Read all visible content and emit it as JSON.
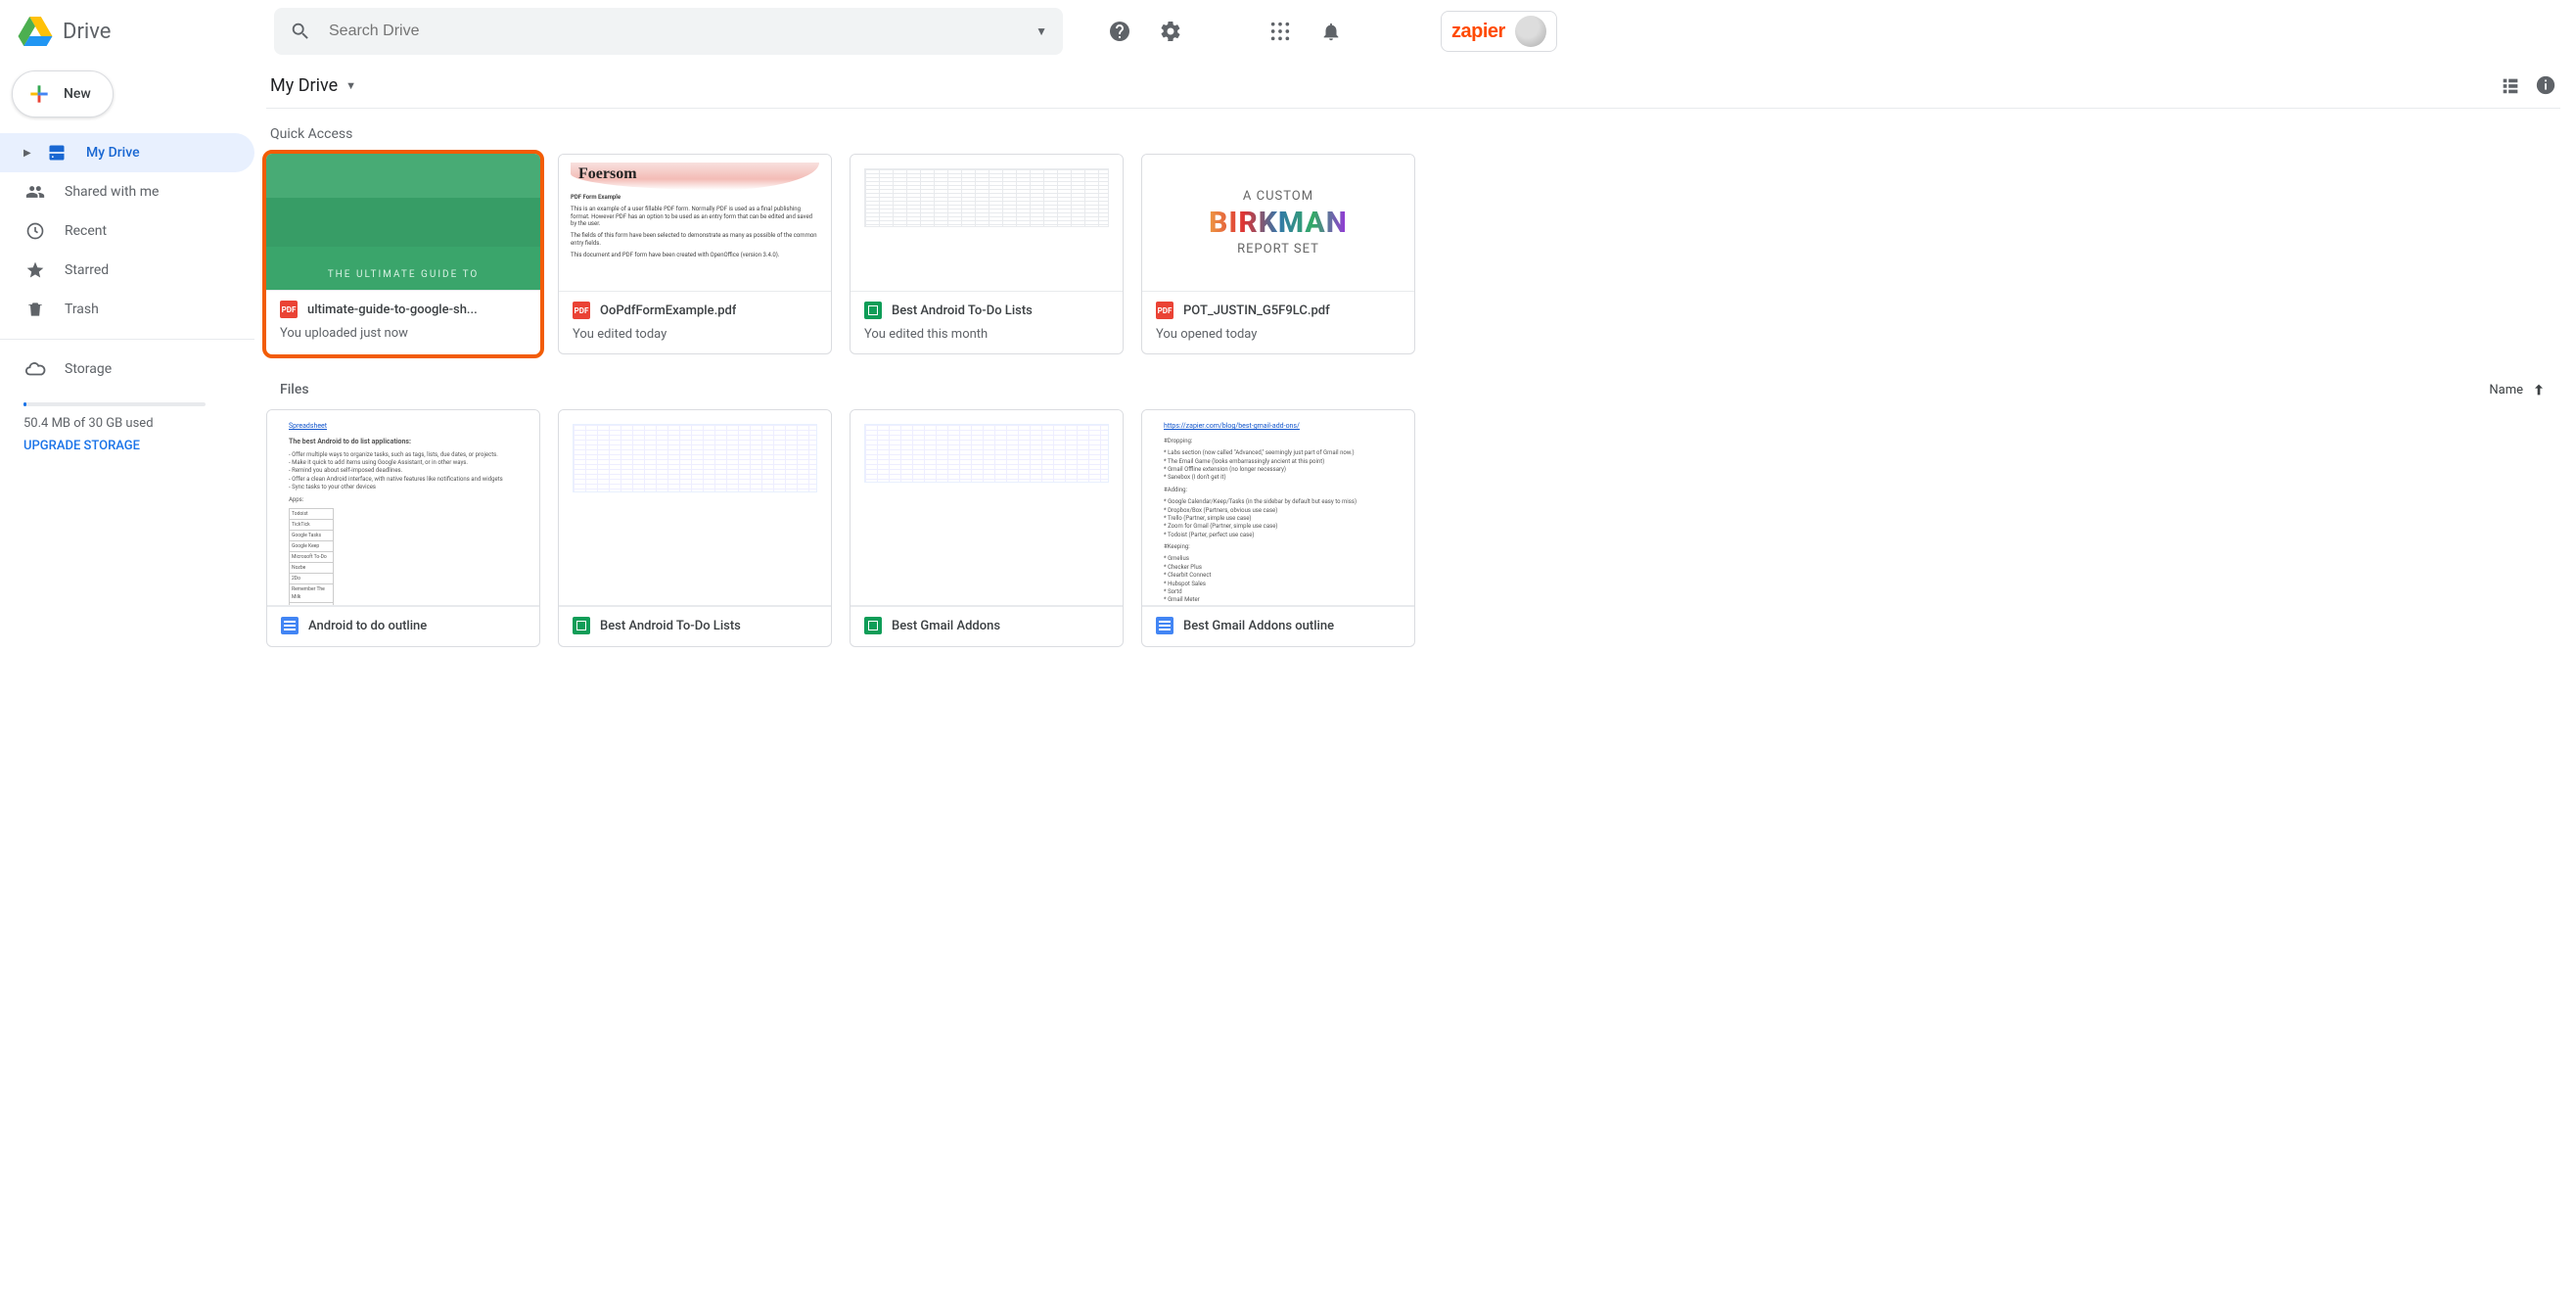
{
  "app": {
    "product_name": "Drive",
    "search_placeholder": "Search Drive",
    "brand_label": "zapier"
  },
  "sidebar": {
    "new_label": "New",
    "items": [
      {
        "label": "My Drive",
        "active": true,
        "icon": "drive"
      },
      {
        "label": "Shared with me",
        "active": false,
        "icon": "people"
      },
      {
        "label": "Recent",
        "active": false,
        "icon": "clock"
      },
      {
        "label": "Starred",
        "active": false,
        "icon": "star"
      },
      {
        "label": "Trash",
        "active": false,
        "icon": "trash"
      }
    ],
    "storage": {
      "label": "Storage",
      "usage_text": "50.4 MB of 30 GB used",
      "upgrade_label": "UPGRADE STORAGE"
    }
  },
  "main": {
    "path_label": "My Drive",
    "quick_access_label": "Quick Access",
    "files_label": "Files",
    "sort_label": "Name",
    "quick_access": [
      {
        "title": "ultimate-guide-to-google-sh...",
        "subtitle": "You uploaded just now",
        "type": "pdf",
        "thumb_text": "THE ULTIMATE GUIDE TO",
        "highlight": true
      },
      {
        "title": "OoPdfFormExample.pdf",
        "subtitle": "You edited today",
        "type": "pdf",
        "thumb_text": "Foersom",
        "thumb_heading": "PDF Form Example"
      },
      {
        "title": "Best Android To-Do Lists",
        "subtitle": "You edited this month",
        "type": "sheet"
      },
      {
        "title": "POT_JUSTIN_G5F9LC.pdf",
        "subtitle": "You opened today",
        "type": "pdf",
        "birkman_l1": "A CUSTOM",
        "birkman_l2": "BIRKMAN",
        "birkman_l3": "REPORT SET"
      }
    ],
    "files": [
      {
        "title": "Android to do outline",
        "type": "doc"
      },
      {
        "title": "Best Android To-Do Lists",
        "type": "sheet"
      },
      {
        "title": "Best Gmail Addons",
        "type": "sheet"
      },
      {
        "title": "Best Gmail Addons outline",
        "type": "doc"
      }
    ]
  }
}
